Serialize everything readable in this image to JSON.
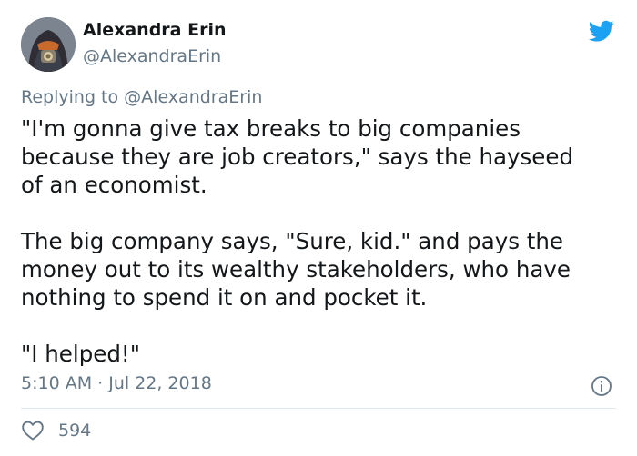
{
  "author": {
    "name": "Alexandra Erin",
    "handle": "@AlexandraErin"
  },
  "reply": {
    "prefix": "Replying to",
    "handle": "@AlexandraErin"
  },
  "tweet": {
    "paragraphs": [
      [
        "\"I'm gonna give tax breaks to big companies",
        "because they are job creators,\" says the hayseed",
        "of an economist."
      ],
      [
        "The big company says, \"Sure, kid.\" and pays the",
        "money out to its wealthy stakeholders, who have",
        "nothing to spend it on and pocket it."
      ],
      [
        "\"I helped!\""
      ]
    ]
  },
  "meta": {
    "timestamp": "5:10 AM · Jul 22, 2018"
  },
  "engagement": {
    "likes": "594"
  },
  "icons": {
    "brand": "twitter-bird-icon",
    "info": "info-icon",
    "like": "heart-icon"
  },
  "colors": {
    "brand_blue": "#1da1f2",
    "secondary_text": "#657786",
    "primary_text": "#14171a",
    "divider": "#e1e8ed"
  }
}
